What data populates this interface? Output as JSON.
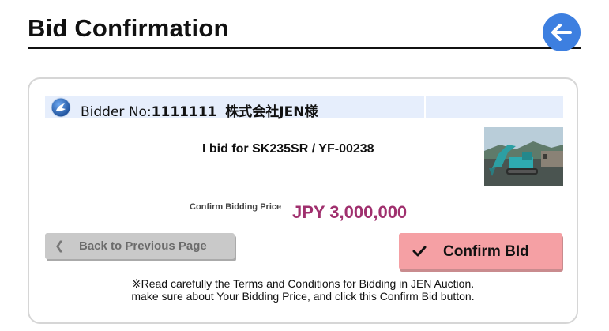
{
  "header": {
    "title": "Bid Confirmation",
    "back_icon": "arrow-left-icon",
    "accent_color": "#3d7fe0"
  },
  "bidder": {
    "icon": "user-badge-icon",
    "label": "Bidder No:",
    "number": "1111111",
    "company": "株式会社JEN様",
    "bar_color": "#e6eefc"
  },
  "item": {
    "bid_text": "I bid for SK235SR / YF-00238",
    "thumbnail": "excavator-photo"
  },
  "price": {
    "label": "Confirm Bidding Price",
    "value": "JPY 3,000,000",
    "color": "#a0306e"
  },
  "actions": {
    "back_chevron": "❮",
    "back_label": "Back to Previous Page",
    "confirm_label": "Confirm BId",
    "confirm_icon": "check-icon",
    "confirm_color": "#f5a0a4"
  },
  "notice": {
    "line1": "※Read carefully the Terms and Conditions for Bidding in JEN Auction.",
    "line2": "make sure about Your Bidding Price, and click this Confirm Bid button."
  }
}
